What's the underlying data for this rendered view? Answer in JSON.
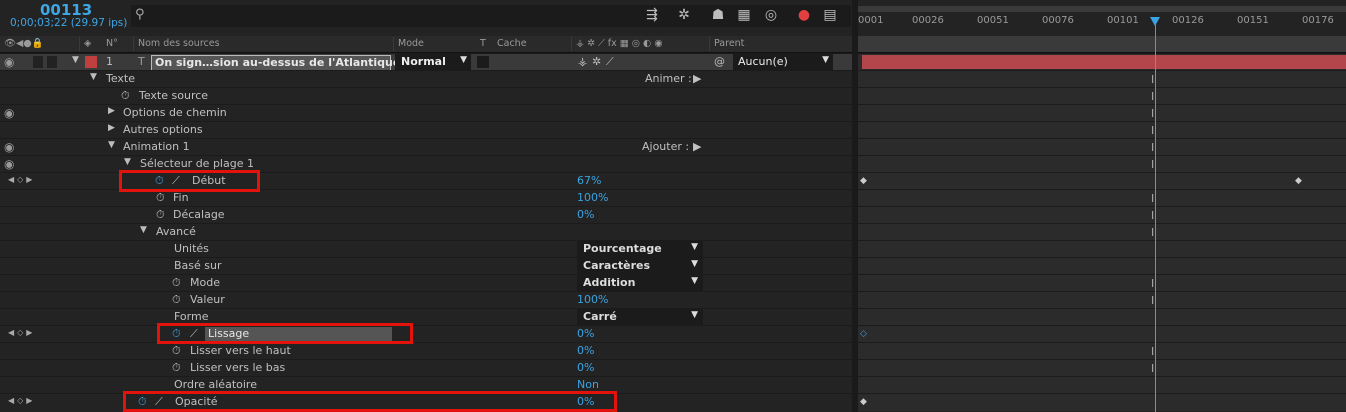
{
  "timecode": {
    "frame": "00113",
    "time": "0;00;03;22 (29.97 ips)"
  },
  "search": {
    "placeholder": ""
  },
  "toolbar_icons": [
    "composition-flowchart-icon",
    "draft-3d-icon",
    "shy-layers-icon",
    "frame-blending-icon",
    "motion-blur-icon",
    "brainstorm-icon",
    "graph-editor-icon"
  ],
  "header": {
    "no": "N°",
    "source": "Nom des sources",
    "mode": "Mode",
    "t": "T",
    "cache": "Cache",
    "parent": "Parent"
  },
  "layer": {
    "number": "1",
    "name": "On sign…sion au-dessus de l'Atlantique.",
    "mode": "Normal",
    "parent": "Aucun(e)",
    "color": "#c04040"
  },
  "rows": {
    "texte": "Texte",
    "animer": "Animer :",
    "texte_source": "Texte source",
    "options_chemin": "Options de chemin",
    "autres_options": "Autres options",
    "animation1": "Animation 1",
    "ajouter": "Ajouter :",
    "selecteur": "Sélecteur de plage 1",
    "debut": "Début",
    "debut_val": "67%",
    "fin": "Fin",
    "fin_val": "100%",
    "decalage": "Décalage",
    "decalage_val": "0%",
    "avance": "Avancé",
    "unites": "Unités",
    "unites_val": "Pourcentage",
    "base_sur": "Basé sur",
    "base_sur_val": "Caractères",
    "mode": "Mode",
    "mode_val": "Addition",
    "valeur": "Valeur",
    "valeur_val": "100%",
    "forme": "Forme",
    "forme_val": "Carré",
    "lissage": "Lissage",
    "lissage_val": "0%",
    "lisser_haut": "Lisser vers le haut",
    "lisser_haut_val": "0%",
    "lisser_bas": "Lisser vers le bas",
    "lisser_bas_val": "0%",
    "ordre": "Ordre aléatoire",
    "ordre_val": "Non",
    "opacite": "Opacité",
    "opacite_val": "0%"
  },
  "timeline": {
    "ticks": [
      "0001",
      "00026",
      "00051",
      "00076",
      "00101",
      "00126",
      "00151",
      "00176"
    ],
    "current_frame_label": "00113"
  },
  "colors": {
    "accent": "#3aa3e3",
    "layer_bar": "#b3464b",
    "highlight": "#e3120b"
  }
}
